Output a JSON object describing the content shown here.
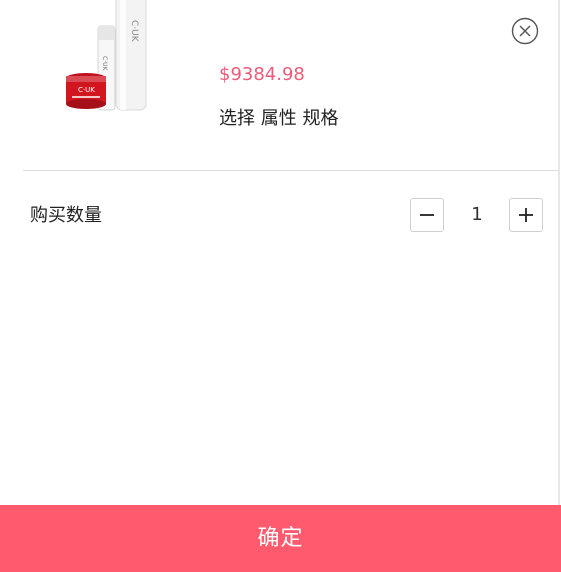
{
  "product": {
    "price": "$9384.98",
    "spec_prompt": "选择 属性 规格",
    "image_icon": "product-thumbnail"
  },
  "quantity": {
    "label": "购买数量",
    "value": "1",
    "decrement_icon": "minus-icon",
    "increment_icon": "plus-icon"
  },
  "close": {
    "icon": "close-icon"
  },
  "footer": {
    "confirm_label": "确定"
  },
  "colors": {
    "accent": "#ff5a6e",
    "price": "#ee5a78",
    "text": "#222222",
    "divider": "#dddddd",
    "border": "#cfcfcf"
  }
}
